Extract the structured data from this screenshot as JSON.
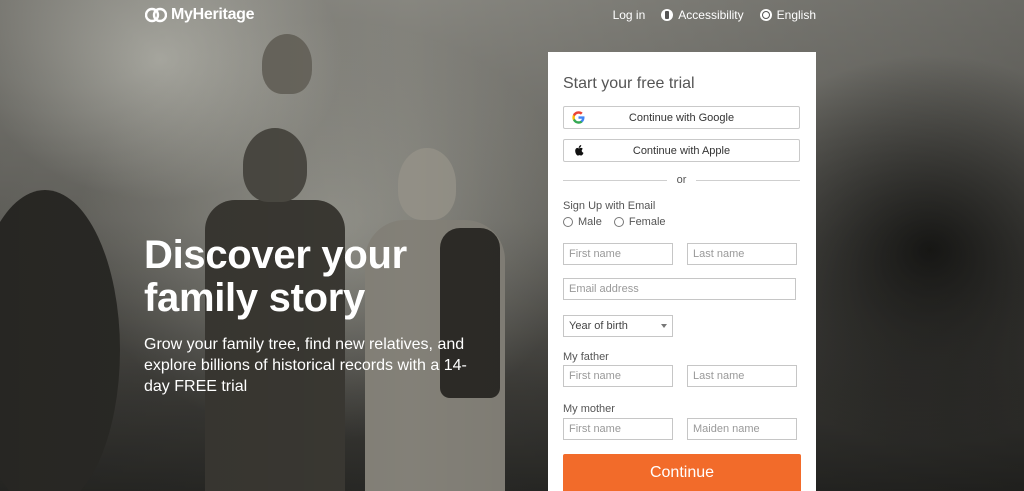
{
  "brand": {
    "name": "MyHeritage"
  },
  "nav": {
    "login": "Log in",
    "accessibility": "Accessibility",
    "language": "English"
  },
  "hero": {
    "title_line1": "Discover your",
    "title_line2": "family story",
    "subtitle": "Grow your family tree, find new relatives, and explore billions of historical records with a 14-day FREE trial"
  },
  "signup": {
    "title": "Start your free trial",
    "google_label": "Continue with Google",
    "apple_label": "Continue with Apple",
    "or_label": "or",
    "email_section_label": "Sign Up with Email",
    "gender_male": "Male",
    "gender_female": "Female",
    "first_name_placeholder": "First name",
    "last_name_placeholder": "Last name",
    "email_placeholder": "Email address",
    "year_of_birth": "Year of birth",
    "father_label": "My father",
    "father_first_placeholder": "First name",
    "father_last_placeholder": "Last name",
    "mother_label": "My mother",
    "mother_first_placeholder": "First name",
    "mother_maiden_placeholder": "Maiden name",
    "continue_label": "Continue"
  },
  "colors": {
    "accent": "#f26b2a",
    "card_bg": "#ffffff",
    "text_muted": "#555555"
  },
  "icons": {
    "logo": "myheritage-logo-icon",
    "accessibility": "accessibility-icon",
    "language": "globe-icon",
    "google": "google-icon",
    "apple": "apple-icon",
    "dropdown": "chevron-down-icon"
  }
}
